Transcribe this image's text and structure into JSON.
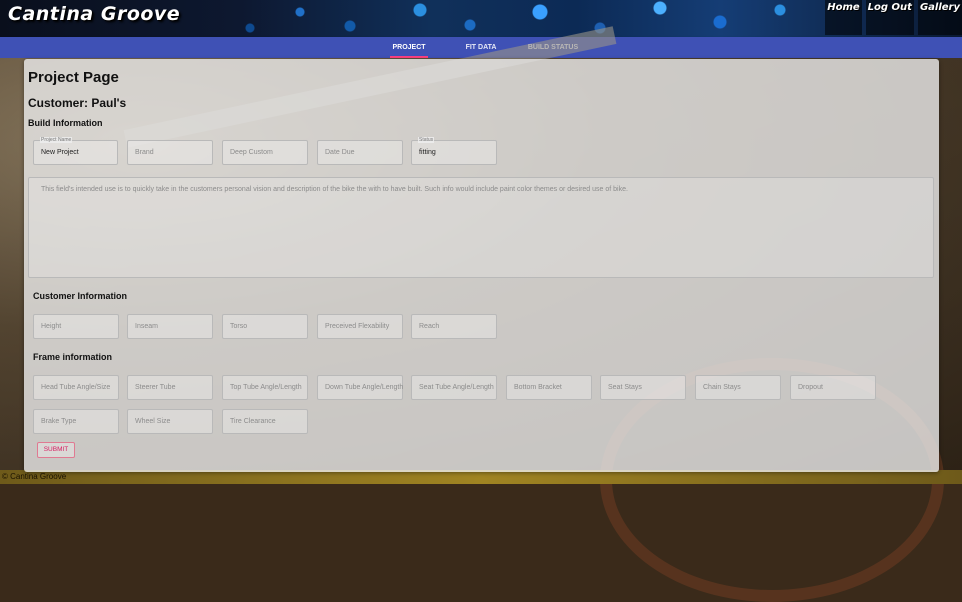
{
  "header": {
    "logo": "Cantina Groove",
    "nav": [
      "Home",
      "Log Out",
      "Gallery"
    ]
  },
  "tabs": [
    {
      "label": "PROJECT",
      "active": true
    },
    {
      "label": "FIT DATA",
      "active": false
    },
    {
      "label": "BUILD STATUS",
      "active": false
    }
  ],
  "page": {
    "title": "Project Page",
    "customer": "Customer: Paul's",
    "build_section": "Build Information",
    "customer_section": "Customer Information",
    "frame_section": "Frame information"
  },
  "build_fields": {
    "project_name": {
      "label": "Project Name",
      "value": "New Project"
    },
    "brand": {
      "placeholder": "Brand"
    },
    "deep_custom": {
      "placeholder": "Deep Custom"
    },
    "date_due": {
      "placeholder": "Date Due"
    },
    "status": {
      "label": "Status",
      "value": "fitting"
    }
  },
  "vision": {
    "placeholder": "This field's intended use is to quickly take in the customers personal vision and description of the bike the with to have built. Such info would include paint color themes or desired use of bike."
  },
  "customer_fields": [
    "Height",
    "Inseam",
    "Torso",
    "Preceived Flexability",
    "Reach"
  ],
  "frame_fields": [
    "Head Tube Angle/Size",
    "Steerer Tube",
    "Top Tube Angle/Length",
    "Down Tube Angle/Length",
    "Seat Tube Angle/Length",
    "Bottom Bracket",
    "Seat Stays",
    "Chain Stays",
    "Dropout"
  ],
  "frame_fields_2": [
    "Brake Type",
    "Wheel Size",
    "Tire Clearance"
  ],
  "submit_label": "SUBMIT",
  "footer": "© Cantina Groove",
  "colors": {
    "tabbar": "#3f51b5",
    "tab_indicator": "#ff4081",
    "submit": "#d81b60"
  }
}
